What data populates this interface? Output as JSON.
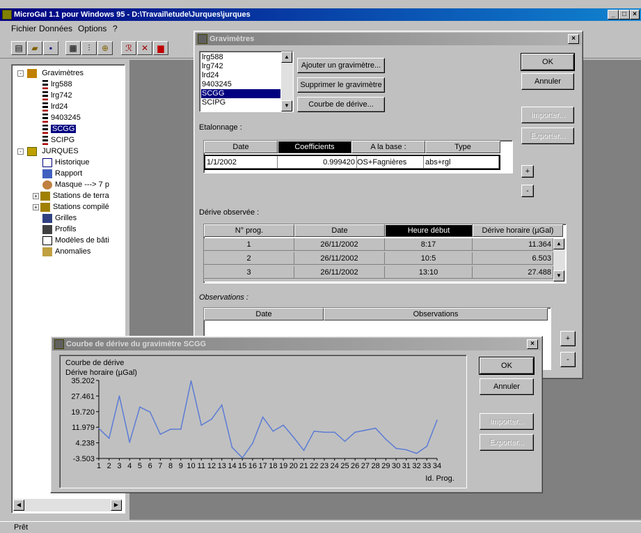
{
  "app": {
    "title": "MicroGal 1.1 pour Windows 95 - D:\\Travail\\etude\\Jurques\\jurques",
    "menu": [
      "Fichier",
      "Données",
      "Options",
      "?"
    ],
    "status": "Prêt"
  },
  "tree": {
    "root_label": "Gravimètres",
    "gravimeters": [
      "lrg588",
      "lrg742",
      "lrd24",
      "9403245",
      "SCGG",
      "SCIPG"
    ],
    "project_label": "JURQUES",
    "project_items": [
      "Historique",
      "Rapport",
      "Masque ---> 7 p",
      "Stations de terra",
      "Stations compilé",
      "Grilles",
      "Profils",
      "Modèles de bâti",
      "Anomalies"
    ]
  },
  "grav_dialog": {
    "title": "Gravimètres",
    "list_items": [
      "lrg588",
      "lrg742",
      "lrd24",
      "9403245",
      "SCGG",
      "SCIPG"
    ],
    "selected_index": 4,
    "add_button": "Ajouter un gravimètre...",
    "remove_button": "Supprimer le gravimètre",
    "curve_button": "Courbe de dérive...",
    "ok": "OK",
    "cancel": "Annuler",
    "import": "Importer...",
    "export": "Exporter...",
    "etalonnage_label": "Etalonnage :",
    "etalonnage_headers": [
      "Date",
      "Coefficients",
      "A la base :",
      "Type"
    ],
    "etalonnage_row": [
      "1/1/2002",
      "0.999420",
      "OS+Fagnières",
      "abs+rgl"
    ],
    "derive_label": "Dérive observée :",
    "derive_headers": [
      "N° prog.",
      "Date",
      "Heure début",
      "Dérive horaire (µGal)"
    ],
    "derive_rows": [
      [
        "1",
        "26/11/2002",
        "8:17",
        "11.364"
      ],
      [
        "2",
        "26/11/2002",
        "10:5",
        "6.503"
      ],
      [
        "3",
        "26/11/2002",
        "13:10",
        "27.488"
      ]
    ],
    "observations_label": "Observations :",
    "observations_headers": [
      "Date",
      "Observations"
    ],
    "plus": "+",
    "minus": "-"
  },
  "curve_dialog": {
    "title": "Courbe de dérive du gravimètre SCGG",
    "ok": "OK",
    "cancel": "Annuler",
    "import": "Importer...",
    "export": "Exporter..."
  },
  "chart_data": {
    "type": "line",
    "title": "Courbe de dérive",
    "ylabel": "Dérive horaire (µGal)",
    "xlabel": "Id. Prog.",
    "y_ticks": [
      "35.202",
      "27.461",
      "19.720",
      "11.979",
      "4.238",
      "-3.503"
    ],
    "ylim": [
      -3.503,
      35.202
    ],
    "x": [
      1,
      2,
      3,
      4,
      5,
      6,
      7,
      8,
      9,
      10,
      11,
      12,
      13,
      14,
      15,
      16,
      17,
      18,
      19,
      20,
      21,
      22,
      23,
      24,
      25,
      26,
      27,
      28,
      29,
      30,
      31,
      32,
      33,
      34
    ],
    "values": [
      11.364,
      6.503,
      27.488,
      4.5,
      22.0,
      19.5,
      8.5,
      11.0,
      11.0,
      35.0,
      13.0,
      16.0,
      23.0,
      2.0,
      -3.2,
      4.0,
      17.0,
      10.0,
      13.0,
      7.0,
      0.5,
      10.0,
      9.5,
      9.5,
      5.0,
      9.5,
      10.5,
      11.5,
      6.0,
      1.5,
      0.8,
      -1.0,
      2.5,
      15.5
    ],
    "grid": false,
    "color": "#5b7bd5"
  },
  "colors": {
    "desktop": "#808080",
    "title_active": "#000080",
    "window_face": "#c0c0c0"
  }
}
